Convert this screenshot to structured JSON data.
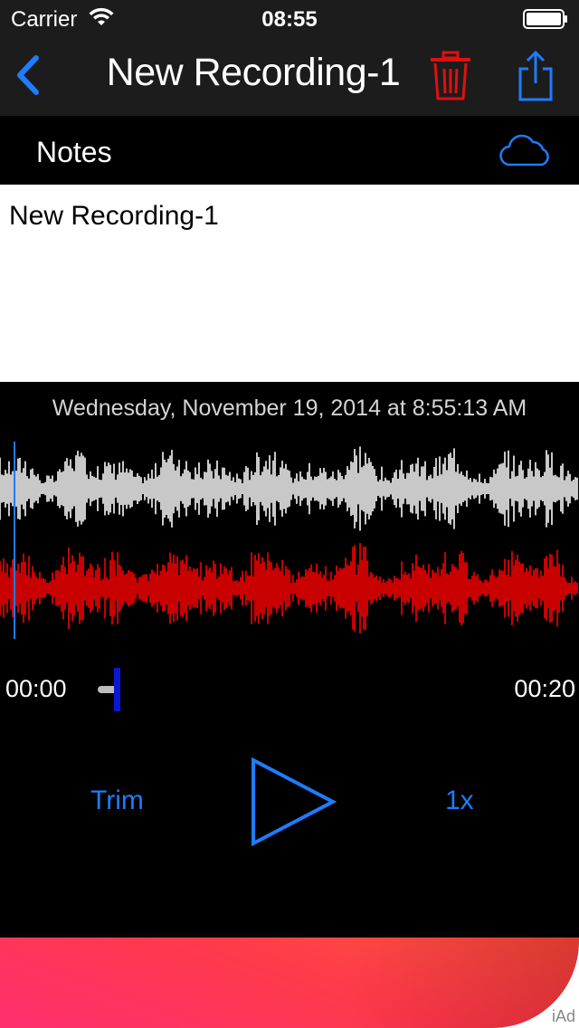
{
  "status_bar": {
    "carrier": "Carrier",
    "time": "08:55"
  },
  "nav": {
    "title": "New Recording-1",
    "back_icon": "chevron-left-icon",
    "trash_icon": "trash-icon",
    "share_icon": "share-icon"
  },
  "notes": {
    "header_label": "Notes",
    "cloud_icon": "cloud-icon",
    "text": "New Recording-1"
  },
  "recording": {
    "date": "Wednesday, November 19, 2014 at 8:55:13 AM",
    "time_start": "00:00",
    "time_end": "00:20",
    "playback_position": 0.0
  },
  "controls": {
    "trim_label": "Trim",
    "speed_label": "1x",
    "play_icon": "play-icon"
  },
  "ad": {
    "label": "iAd"
  },
  "colors": {
    "accent": "#1e7cff",
    "destructive": "#e01010",
    "wave_top": "#c8c8c8",
    "wave_bottom": "#c80000",
    "scrub_thumb": "#0a17d6"
  }
}
